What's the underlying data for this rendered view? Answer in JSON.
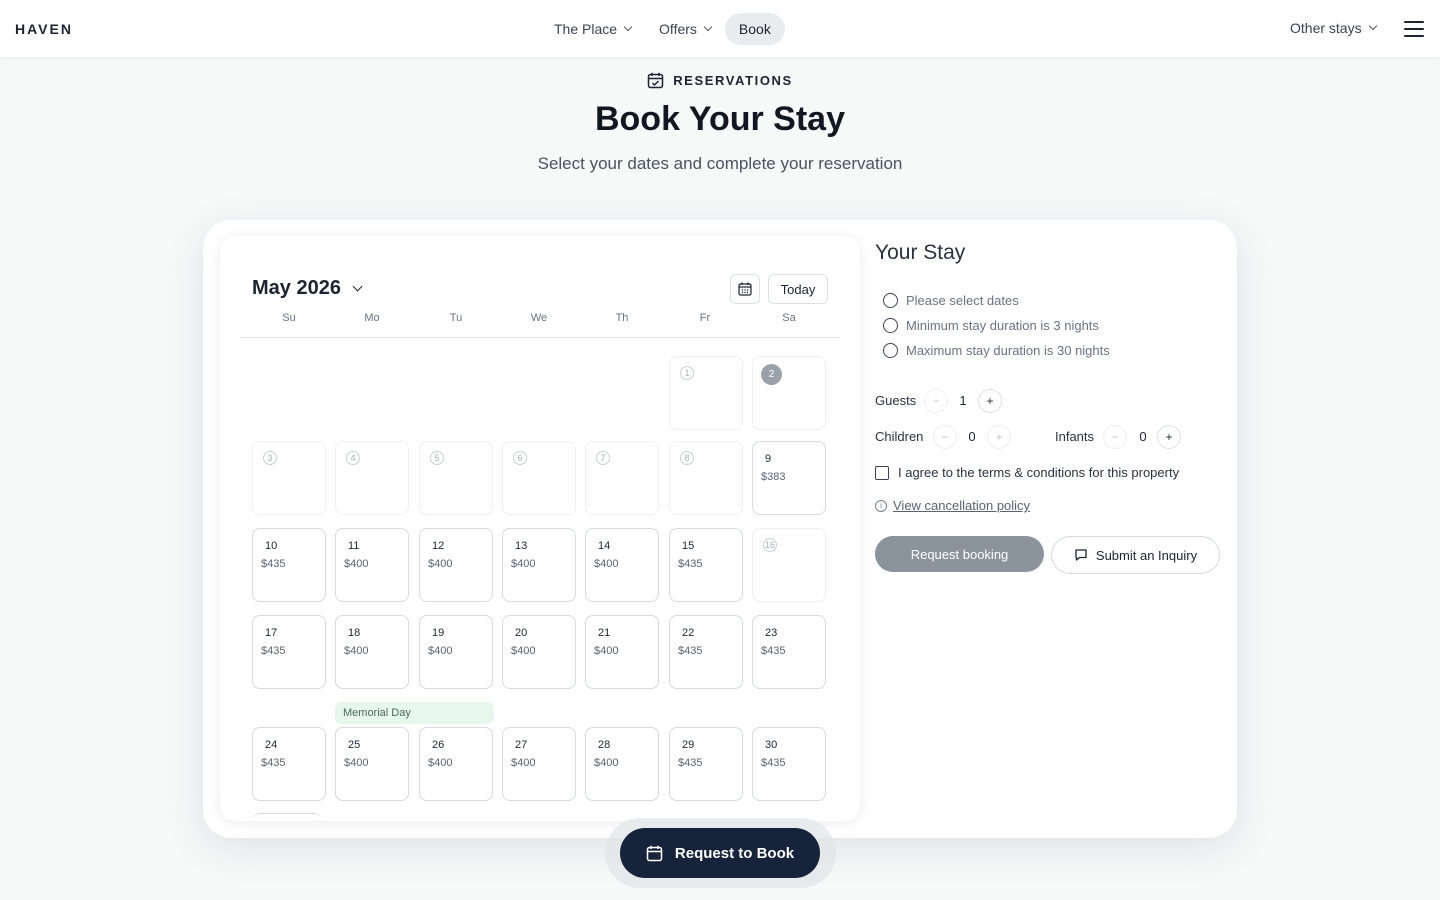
{
  "header": {
    "logo": "HAVEN",
    "nav": [
      {
        "label": "The Place",
        "dropdown": true
      },
      {
        "label": "Offers",
        "dropdown": true
      },
      {
        "label": "Book",
        "dropdown": false,
        "active": true
      }
    ],
    "other_stays": "Other stays"
  },
  "hero": {
    "eyebrow": "RESERVATIONS",
    "title": "Book Your Stay",
    "subtitle": "Select your dates and complete your reservation"
  },
  "calendar": {
    "month": "May 2026",
    "today_label": "Today",
    "weekdays": [
      "Su",
      "Mo",
      "Tu",
      "We",
      "Th",
      "Fr",
      "Sa"
    ],
    "holiday": "Memorial Day",
    "days": [
      {
        "day": "1",
        "price": "",
        "state": "disabled"
      },
      {
        "day": "2",
        "price": "",
        "state": "today"
      },
      {
        "day": "3",
        "price": "",
        "state": "disabled"
      },
      {
        "day": "4",
        "price": "",
        "state": "disabled"
      },
      {
        "day": "5",
        "price": "",
        "state": "disabled"
      },
      {
        "day": "6",
        "price": "",
        "state": "disabled"
      },
      {
        "day": "7",
        "price": "",
        "state": "disabled"
      },
      {
        "day": "8",
        "price": "",
        "state": "disabled"
      },
      {
        "day": "9",
        "price": "$383",
        "state": "available"
      },
      {
        "day": "10",
        "price": "$435",
        "state": "available"
      },
      {
        "day": "11",
        "price": "$400",
        "state": "available"
      },
      {
        "day": "12",
        "price": "$400",
        "state": "available"
      },
      {
        "day": "13",
        "price": "$400",
        "state": "available"
      },
      {
        "day": "14",
        "price": "$400",
        "state": "available"
      },
      {
        "day": "15",
        "price": "$435",
        "state": "available"
      },
      {
        "day": "16",
        "price": "",
        "state": "disabled"
      },
      {
        "day": "17",
        "price": "$435",
        "state": "available"
      },
      {
        "day": "18",
        "price": "$400",
        "state": "available"
      },
      {
        "day": "19",
        "price": "$400",
        "state": "available"
      },
      {
        "day": "20",
        "price": "$400",
        "state": "available"
      },
      {
        "day": "21",
        "price": "$400",
        "state": "available"
      },
      {
        "day": "22",
        "price": "$435",
        "state": "available"
      },
      {
        "day": "23",
        "price": "$435",
        "state": "available"
      },
      {
        "day": "24",
        "price": "$435",
        "state": "available"
      },
      {
        "day": "25",
        "price": "$400",
        "state": "available"
      },
      {
        "day": "26",
        "price": "$400",
        "state": "available"
      },
      {
        "day": "27",
        "price": "$400",
        "state": "available"
      },
      {
        "day": "28",
        "price": "$400",
        "state": "available"
      },
      {
        "day": "29",
        "price": "$435",
        "state": "available"
      },
      {
        "day": "30",
        "price": "$435",
        "state": "available"
      }
    ]
  },
  "stay": {
    "title": "Your Stay",
    "requirements": [
      "Please select dates",
      "Minimum stay duration is 3 nights",
      "Maximum stay duration is 30 nights"
    ],
    "guests": {
      "label": "Guests",
      "value": "1"
    },
    "children": {
      "label": "Children",
      "value": "0"
    },
    "infants": {
      "label": "Infants",
      "value": "0"
    },
    "terms": "I agree to the terms & conditions for this property",
    "policy_link": "View cancellation policy",
    "request_button": "Request booking",
    "inquiry_button": "Submit an Inquiry"
  },
  "cta": {
    "label": "Request to Book"
  },
  "colors": {
    "primary_dark": "#16233b",
    "disabled_button": "#8b939c",
    "holiday_bg": "#e8f7ee"
  }
}
